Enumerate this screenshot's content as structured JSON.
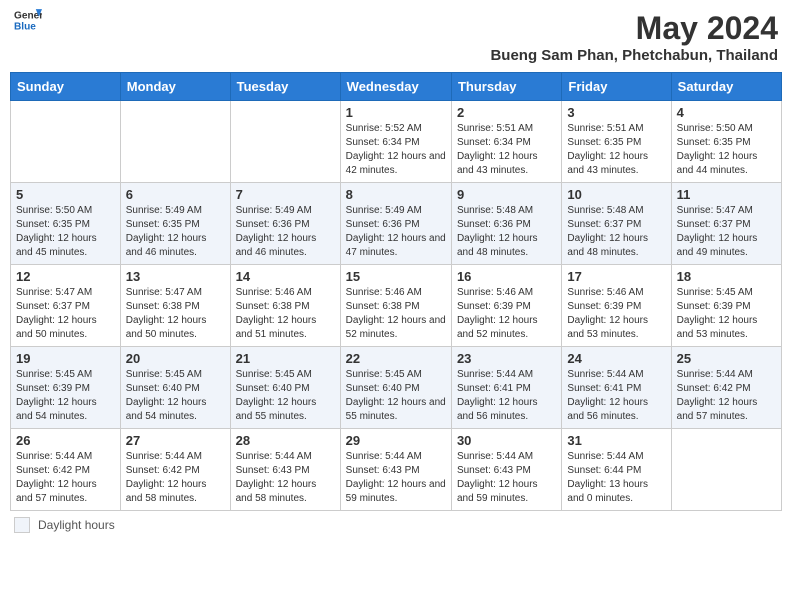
{
  "header": {
    "logo_line1": "General",
    "logo_line2": "Blue",
    "month_year": "May 2024",
    "location": "Bueng Sam Phan, Phetchabun, Thailand"
  },
  "days_of_week": [
    "Sunday",
    "Monday",
    "Tuesday",
    "Wednesday",
    "Thursday",
    "Friday",
    "Saturday"
  ],
  "footer": {
    "daylight_label": "Daylight hours"
  },
  "weeks": [
    [
      {
        "num": "",
        "info": ""
      },
      {
        "num": "",
        "info": ""
      },
      {
        "num": "",
        "info": ""
      },
      {
        "num": "1",
        "info": "Sunrise: 5:52 AM\nSunset: 6:34 PM\nDaylight: 12 hours and 42 minutes."
      },
      {
        "num": "2",
        "info": "Sunrise: 5:51 AM\nSunset: 6:34 PM\nDaylight: 12 hours and 43 minutes."
      },
      {
        "num": "3",
        "info": "Sunrise: 5:51 AM\nSunset: 6:35 PM\nDaylight: 12 hours and 43 minutes."
      },
      {
        "num": "4",
        "info": "Sunrise: 5:50 AM\nSunset: 6:35 PM\nDaylight: 12 hours and 44 minutes."
      }
    ],
    [
      {
        "num": "5",
        "info": "Sunrise: 5:50 AM\nSunset: 6:35 PM\nDaylight: 12 hours and 45 minutes."
      },
      {
        "num": "6",
        "info": "Sunrise: 5:49 AM\nSunset: 6:35 PM\nDaylight: 12 hours and 46 minutes."
      },
      {
        "num": "7",
        "info": "Sunrise: 5:49 AM\nSunset: 6:36 PM\nDaylight: 12 hours and 46 minutes."
      },
      {
        "num": "8",
        "info": "Sunrise: 5:49 AM\nSunset: 6:36 PM\nDaylight: 12 hours and 47 minutes."
      },
      {
        "num": "9",
        "info": "Sunrise: 5:48 AM\nSunset: 6:36 PM\nDaylight: 12 hours and 48 minutes."
      },
      {
        "num": "10",
        "info": "Sunrise: 5:48 AM\nSunset: 6:37 PM\nDaylight: 12 hours and 48 minutes."
      },
      {
        "num": "11",
        "info": "Sunrise: 5:47 AM\nSunset: 6:37 PM\nDaylight: 12 hours and 49 minutes."
      }
    ],
    [
      {
        "num": "12",
        "info": "Sunrise: 5:47 AM\nSunset: 6:37 PM\nDaylight: 12 hours and 50 minutes."
      },
      {
        "num": "13",
        "info": "Sunrise: 5:47 AM\nSunset: 6:38 PM\nDaylight: 12 hours and 50 minutes."
      },
      {
        "num": "14",
        "info": "Sunrise: 5:46 AM\nSunset: 6:38 PM\nDaylight: 12 hours and 51 minutes."
      },
      {
        "num": "15",
        "info": "Sunrise: 5:46 AM\nSunset: 6:38 PM\nDaylight: 12 hours and 52 minutes."
      },
      {
        "num": "16",
        "info": "Sunrise: 5:46 AM\nSunset: 6:39 PM\nDaylight: 12 hours and 52 minutes."
      },
      {
        "num": "17",
        "info": "Sunrise: 5:46 AM\nSunset: 6:39 PM\nDaylight: 12 hours and 53 minutes."
      },
      {
        "num": "18",
        "info": "Sunrise: 5:45 AM\nSunset: 6:39 PM\nDaylight: 12 hours and 53 minutes."
      }
    ],
    [
      {
        "num": "19",
        "info": "Sunrise: 5:45 AM\nSunset: 6:39 PM\nDaylight: 12 hours and 54 minutes."
      },
      {
        "num": "20",
        "info": "Sunrise: 5:45 AM\nSunset: 6:40 PM\nDaylight: 12 hours and 54 minutes."
      },
      {
        "num": "21",
        "info": "Sunrise: 5:45 AM\nSunset: 6:40 PM\nDaylight: 12 hours and 55 minutes."
      },
      {
        "num": "22",
        "info": "Sunrise: 5:45 AM\nSunset: 6:40 PM\nDaylight: 12 hours and 55 minutes."
      },
      {
        "num": "23",
        "info": "Sunrise: 5:44 AM\nSunset: 6:41 PM\nDaylight: 12 hours and 56 minutes."
      },
      {
        "num": "24",
        "info": "Sunrise: 5:44 AM\nSunset: 6:41 PM\nDaylight: 12 hours and 56 minutes."
      },
      {
        "num": "25",
        "info": "Sunrise: 5:44 AM\nSunset: 6:42 PM\nDaylight: 12 hours and 57 minutes."
      }
    ],
    [
      {
        "num": "26",
        "info": "Sunrise: 5:44 AM\nSunset: 6:42 PM\nDaylight: 12 hours and 57 minutes."
      },
      {
        "num": "27",
        "info": "Sunrise: 5:44 AM\nSunset: 6:42 PM\nDaylight: 12 hours and 58 minutes."
      },
      {
        "num": "28",
        "info": "Sunrise: 5:44 AM\nSunset: 6:43 PM\nDaylight: 12 hours and 58 minutes."
      },
      {
        "num": "29",
        "info": "Sunrise: 5:44 AM\nSunset: 6:43 PM\nDaylight: 12 hours and 59 minutes."
      },
      {
        "num": "30",
        "info": "Sunrise: 5:44 AM\nSunset: 6:43 PM\nDaylight: 12 hours and 59 minutes."
      },
      {
        "num": "31",
        "info": "Sunrise: 5:44 AM\nSunset: 6:44 PM\nDaylight: 13 hours and 0 minutes."
      },
      {
        "num": "",
        "info": ""
      }
    ]
  ]
}
